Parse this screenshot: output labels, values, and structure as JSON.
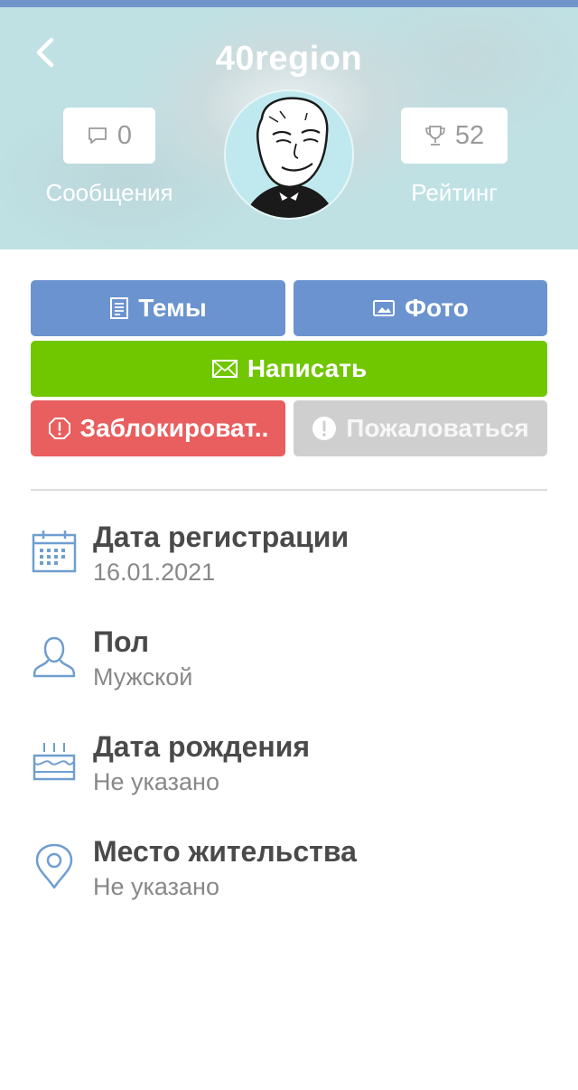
{
  "header": {
    "title": "40region",
    "messages_count": "0",
    "messages_label": "Сообщения",
    "rating_value": "52",
    "rating_label": "Рейтинг"
  },
  "actions": {
    "themes_label": "Темы",
    "photo_label": "Фото",
    "write_label": "Написать",
    "block_label": "Заблокироват..",
    "report_label": "Пожаловаться"
  },
  "info": [
    {
      "title": "Дата регистрации",
      "value": "16.01.2021",
      "icon": "calendar-icon"
    },
    {
      "title": "Пол",
      "value": "Мужской",
      "icon": "user-icon"
    },
    {
      "title": "Дата рождения",
      "value": "Не указано",
      "icon": "cake-icon"
    },
    {
      "title": "Место жительства",
      "value": "Не указано",
      "icon": "location-pin-icon"
    }
  ],
  "colors": {
    "accent_blue": "#6b93cf",
    "write_green": "#70c700",
    "block_red": "#e95e5e",
    "report_gray": "#cfcfcf",
    "header_bg": "#bfe1e4"
  }
}
